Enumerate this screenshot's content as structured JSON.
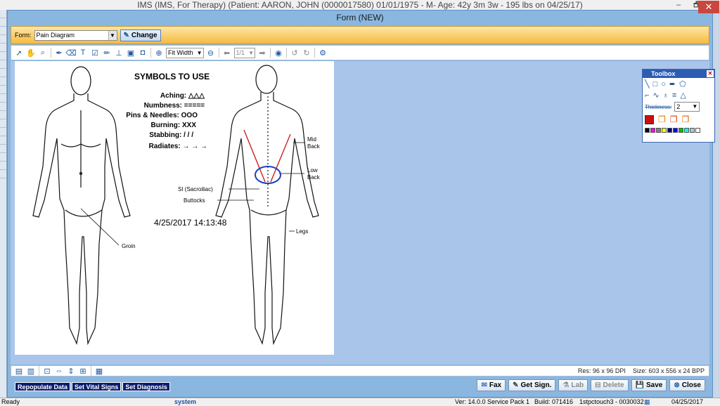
{
  "app": {
    "title": "IMS (IMS, For Therapy)    (Patient: AARON, JOHN  (0000017580) 01/01/1975 - M- Age: 42y 3m 3w - 195 lbs on 04/25/17)",
    "min_label": "–",
    "restore_label": "🗗",
    "close_label": "✕"
  },
  "form": {
    "title": "Form (NEW)",
    "close_label": "✕"
  },
  "selector": {
    "label": "Form:",
    "value": "Pain Diagram",
    "change_label": "Change"
  },
  "toolbar": {
    "zoom": "Fit Width",
    "page": "1/1"
  },
  "diagram": {
    "heading": "SYMBOLS TO USE",
    "symbols": [
      "Aching: △△△",
      "Numbness: =====",
      "Pins & Needles: OOO",
      "Burning: XXX",
      "Stabbing: / / /",
      "Radiates: → → →"
    ],
    "timestamp": "4/25/2017 14:13:48",
    "labels": {
      "mid_back_1": "Mid",
      "mid_back_2": "Back",
      "low_back_1": "Low",
      "low_back_2": "Back",
      "si": "SI (Sacroiliac)",
      "buttocks": "Buttocks",
      "legs": "Legs",
      "groin": "Groin"
    }
  },
  "toolbox": {
    "title": "Toolbox",
    "thickness_label": "Thickness:",
    "thickness_value": "2",
    "close_label": "✕",
    "colors": [
      "#000000",
      "#ff00ff",
      "#808080",
      "#ffff00",
      "#000080",
      "#0000ff",
      "#00c000",
      "#00ffff",
      "#c0c0c0",
      "#ffffff"
    ]
  },
  "image_info": {
    "res": "Res:  96 x 96 DPI",
    "size": "Size: 603 x 556 x 24 BPP"
  },
  "actions": {
    "repopulate": "Repopulate Data",
    "vitals": "Set Vital Signs",
    "diagnosis": "Set Diagnosis",
    "fax": "Fax",
    "sign": "Get Sign.",
    "lab": "Lab",
    "delete": "Delete",
    "save": "Save",
    "close": "Close"
  },
  "status": {
    "ready": "Ready",
    "user": "system",
    "version": "Ver: 14.0.0 Service Pack 1",
    "build": "Build: 071416",
    "server": "1stpctouch3 - 0030032",
    "date": "04/25/2017"
  },
  "colors": {
    "annotation_red": "#d22020",
    "annotation_blue": "#1f3fbf",
    "accent_orange": "#f6b93f"
  }
}
